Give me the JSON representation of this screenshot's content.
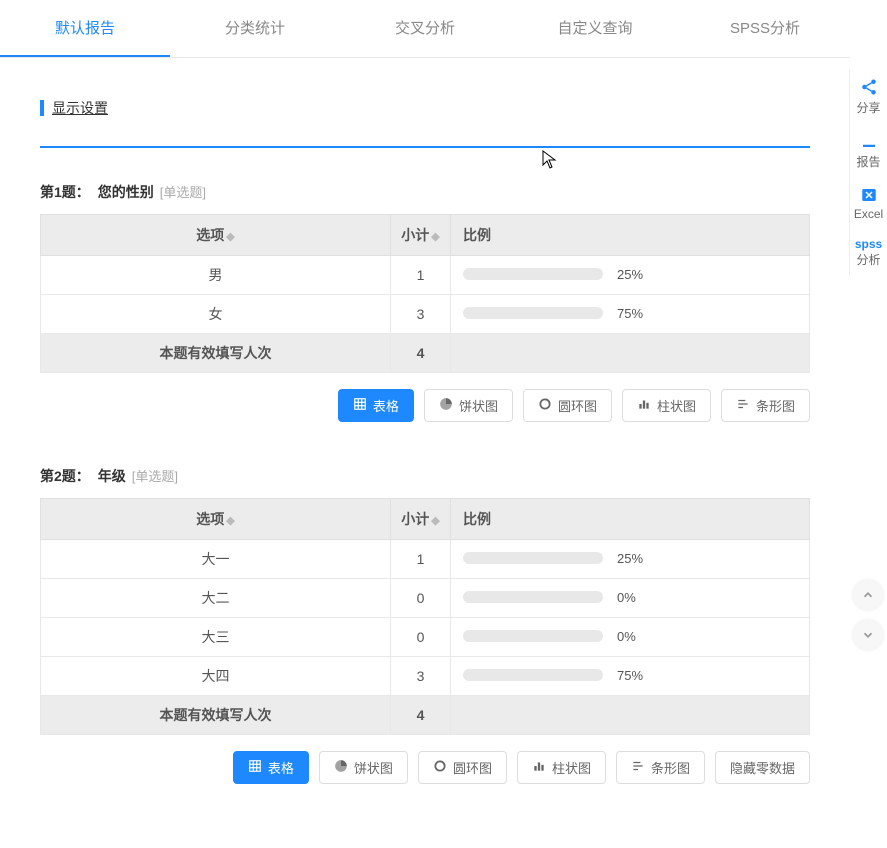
{
  "tabs": [
    "默认报告",
    "分类统计",
    "交叉分析",
    "自定义查询",
    "SPSS分析"
  ],
  "display_settings": "显示设置",
  "headers": {
    "option": "选项",
    "subtotal": "小计",
    "ratio": "比例"
  },
  "footer_label": "本题有效填写人次",
  "chart_btns": {
    "table": "表格",
    "pie": "饼状图",
    "donut": "圆环图",
    "bar": "柱状图",
    "barh": "条形图",
    "hide_zero": "隐藏零数据"
  },
  "sidebar": {
    "share": "分享",
    "report": "报告",
    "excel": "Excel",
    "spss_label": "spss",
    "spss": "分析"
  },
  "questions": [
    {
      "num": "第1题：",
      "title": "您的性别",
      "type": "[单选题]",
      "rows": [
        {
          "option": "男",
          "count": "1",
          "pct": "25%"
        },
        {
          "option": "女",
          "count": "3",
          "pct": "75%"
        }
      ],
      "total": "4",
      "hide_zero": false
    },
    {
      "num": "第2题：",
      "title": "年级",
      "type": "[单选题]",
      "rows": [
        {
          "option": "大一",
          "count": "1",
          "pct": "25%"
        },
        {
          "option": "大二",
          "count": "0",
          "pct": "0%"
        },
        {
          "option": "大三",
          "count": "0",
          "pct": "0%"
        },
        {
          "option": "大四",
          "count": "3",
          "pct": "75%"
        }
      ],
      "total": "4",
      "hide_zero": true
    }
  ],
  "chart_data": [
    {
      "type": "bar",
      "title": "您的性别",
      "categories": [
        "男",
        "女"
      ],
      "values": [
        1,
        3
      ],
      "ylabel": "小计"
    },
    {
      "type": "bar",
      "title": "年级",
      "categories": [
        "大一",
        "大二",
        "大三",
        "大四"
      ],
      "values": [
        1,
        0,
        0,
        3
      ],
      "ylabel": "小计"
    }
  ]
}
